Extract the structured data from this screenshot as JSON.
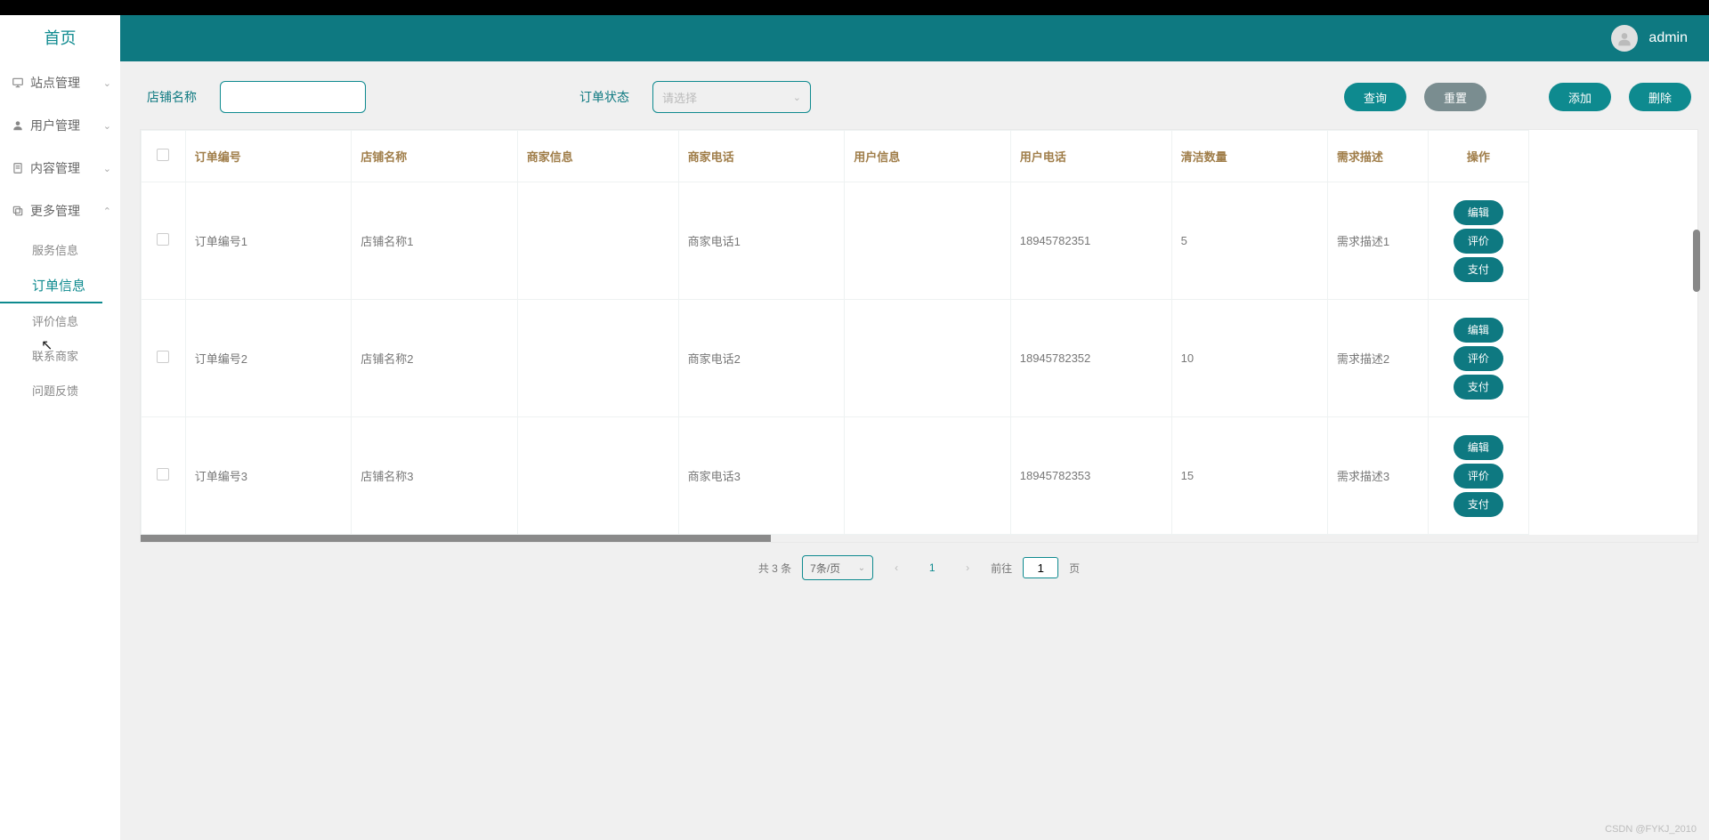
{
  "header": {
    "username": "admin"
  },
  "sidebar": {
    "home": "首页",
    "items": [
      {
        "label": "站点管理",
        "icon": "monitor"
      },
      {
        "label": "用户管理",
        "icon": "user"
      },
      {
        "label": "内容管理",
        "icon": "doc"
      },
      {
        "label": "更多管理",
        "icon": "copy"
      }
    ],
    "sub": [
      {
        "label": "服务信息"
      },
      {
        "label": "订单信息",
        "active": true
      },
      {
        "label": "评价信息"
      },
      {
        "label": "联系商家"
      },
      {
        "label": "问题反馈"
      }
    ]
  },
  "search": {
    "label_shop": "店铺名称",
    "label_status": "订单状态",
    "select_placeholder": "请选择",
    "btn_query": "查询",
    "btn_reset": "重置",
    "btn_add": "添加",
    "btn_delete": "删除"
  },
  "table": {
    "headers": {
      "order": "订单编号",
      "shop": "店铺名称",
      "merchant_info": "商家信息",
      "merchant_phone": "商家电话",
      "user_info": "用户信息",
      "user_phone": "用户电话",
      "qty": "清洁数量",
      "desc": "需求描述",
      "ops": "操作"
    },
    "rows": [
      {
        "order": "订单编号1",
        "shop": "店铺名称1",
        "merchant_info": "",
        "merchant_phone": "商家电话1",
        "user_info": "",
        "user_phone": "18945782351",
        "qty": "5",
        "desc": "需求描述1"
      },
      {
        "order": "订单编号2",
        "shop": "店铺名称2",
        "merchant_info": "",
        "merchant_phone": "商家电话2",
        "user_info": "",
        "user_phone": "18945782352",
        "qty": "10",
        "desc": "需求描述2"
      },
      {
        "order": "订单编号3",
        "shop": "店铺名称3",
        "merchant_info": "",
        "merchant_phone": "商家电话3",
        "user_info": "",
        "user_phone": "18945782353",
        "qty": "15",
        "desc": "需求描述3"
      }
    ],
    "row_btn_edit": "编辑",
    "row_btn_review": "评价",
    "row_btn_pay": "支付"
  },
  "pager": {
    "total": "共 3 条",
    "per_page": "7条/页",
    "current": "1",
    "goto_prefix": "前往",
    "goto_value": "1",
    "goto_suffix": "页"
  },
  "watermark": "CSDN @FYKJ_2010"
}
